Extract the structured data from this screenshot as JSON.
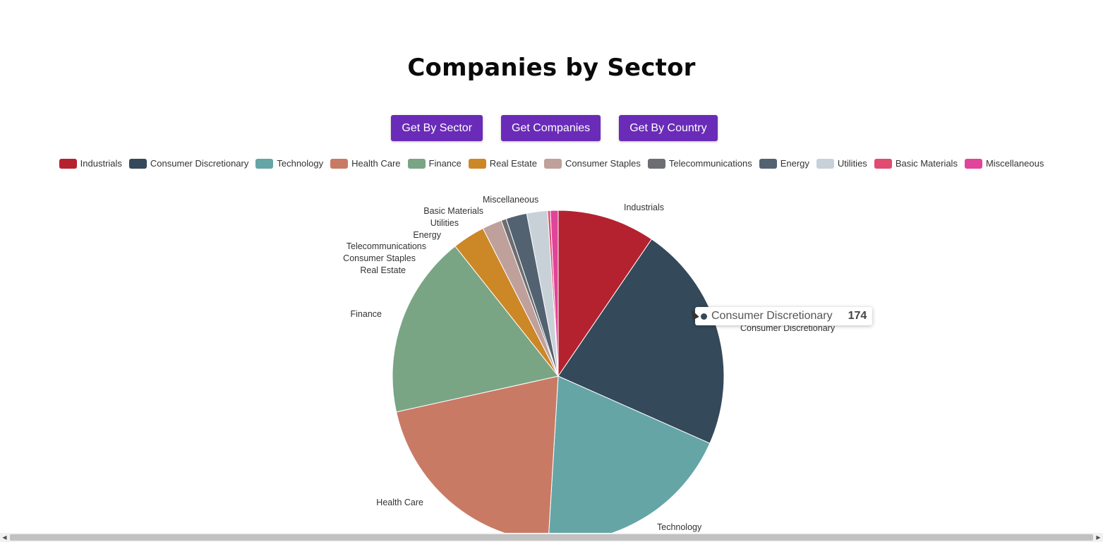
{
  "title": "Companies by Sector",
  "buttons": {
    "by_sector": "Get By Sector",
    "companies": "Get Companies",
    "by_country": "Get By Country"
  },
  "tooltip": {
    "label": "Consumer Discretionary",
    "value": "174",
    "color": "#34495a"
  },
  "colors": {
    "button": "#6a2bb8"
  },
  "chart_data": {
    "type": "pie",
    "title": "Companies by Sector",
    "legend_position": "top",
    "start_angle": "top, clockwise",
    "categories": [
      "Industrials",
      "Consumer Discretionary",
      "Technology",
      "Health Care",
      "Finance",
      "Real Estate",
      "Consumer Staples",
      "Telecommunications",
      "Energy",
      "Utilities",
      "Basic Materials",
      "Miscellaneous"
    ],
    "values": [
      75,
      174,
      152,
      162,
      140,
      25,
      15,
      4,
      16,
      16,
      2,
      6
    ],
    "colors": [
      "#b5222f",
      "#34495a",
      "#65a5a6",
      "#c97a65",
      "#79a584",
      "#cc8726",
      "#bfa09b",
      "#6c6e72",
      "#526270",
      "#c9d1d8",
      "#e04b72",
      "#e0449b"
    ]
  }
}
